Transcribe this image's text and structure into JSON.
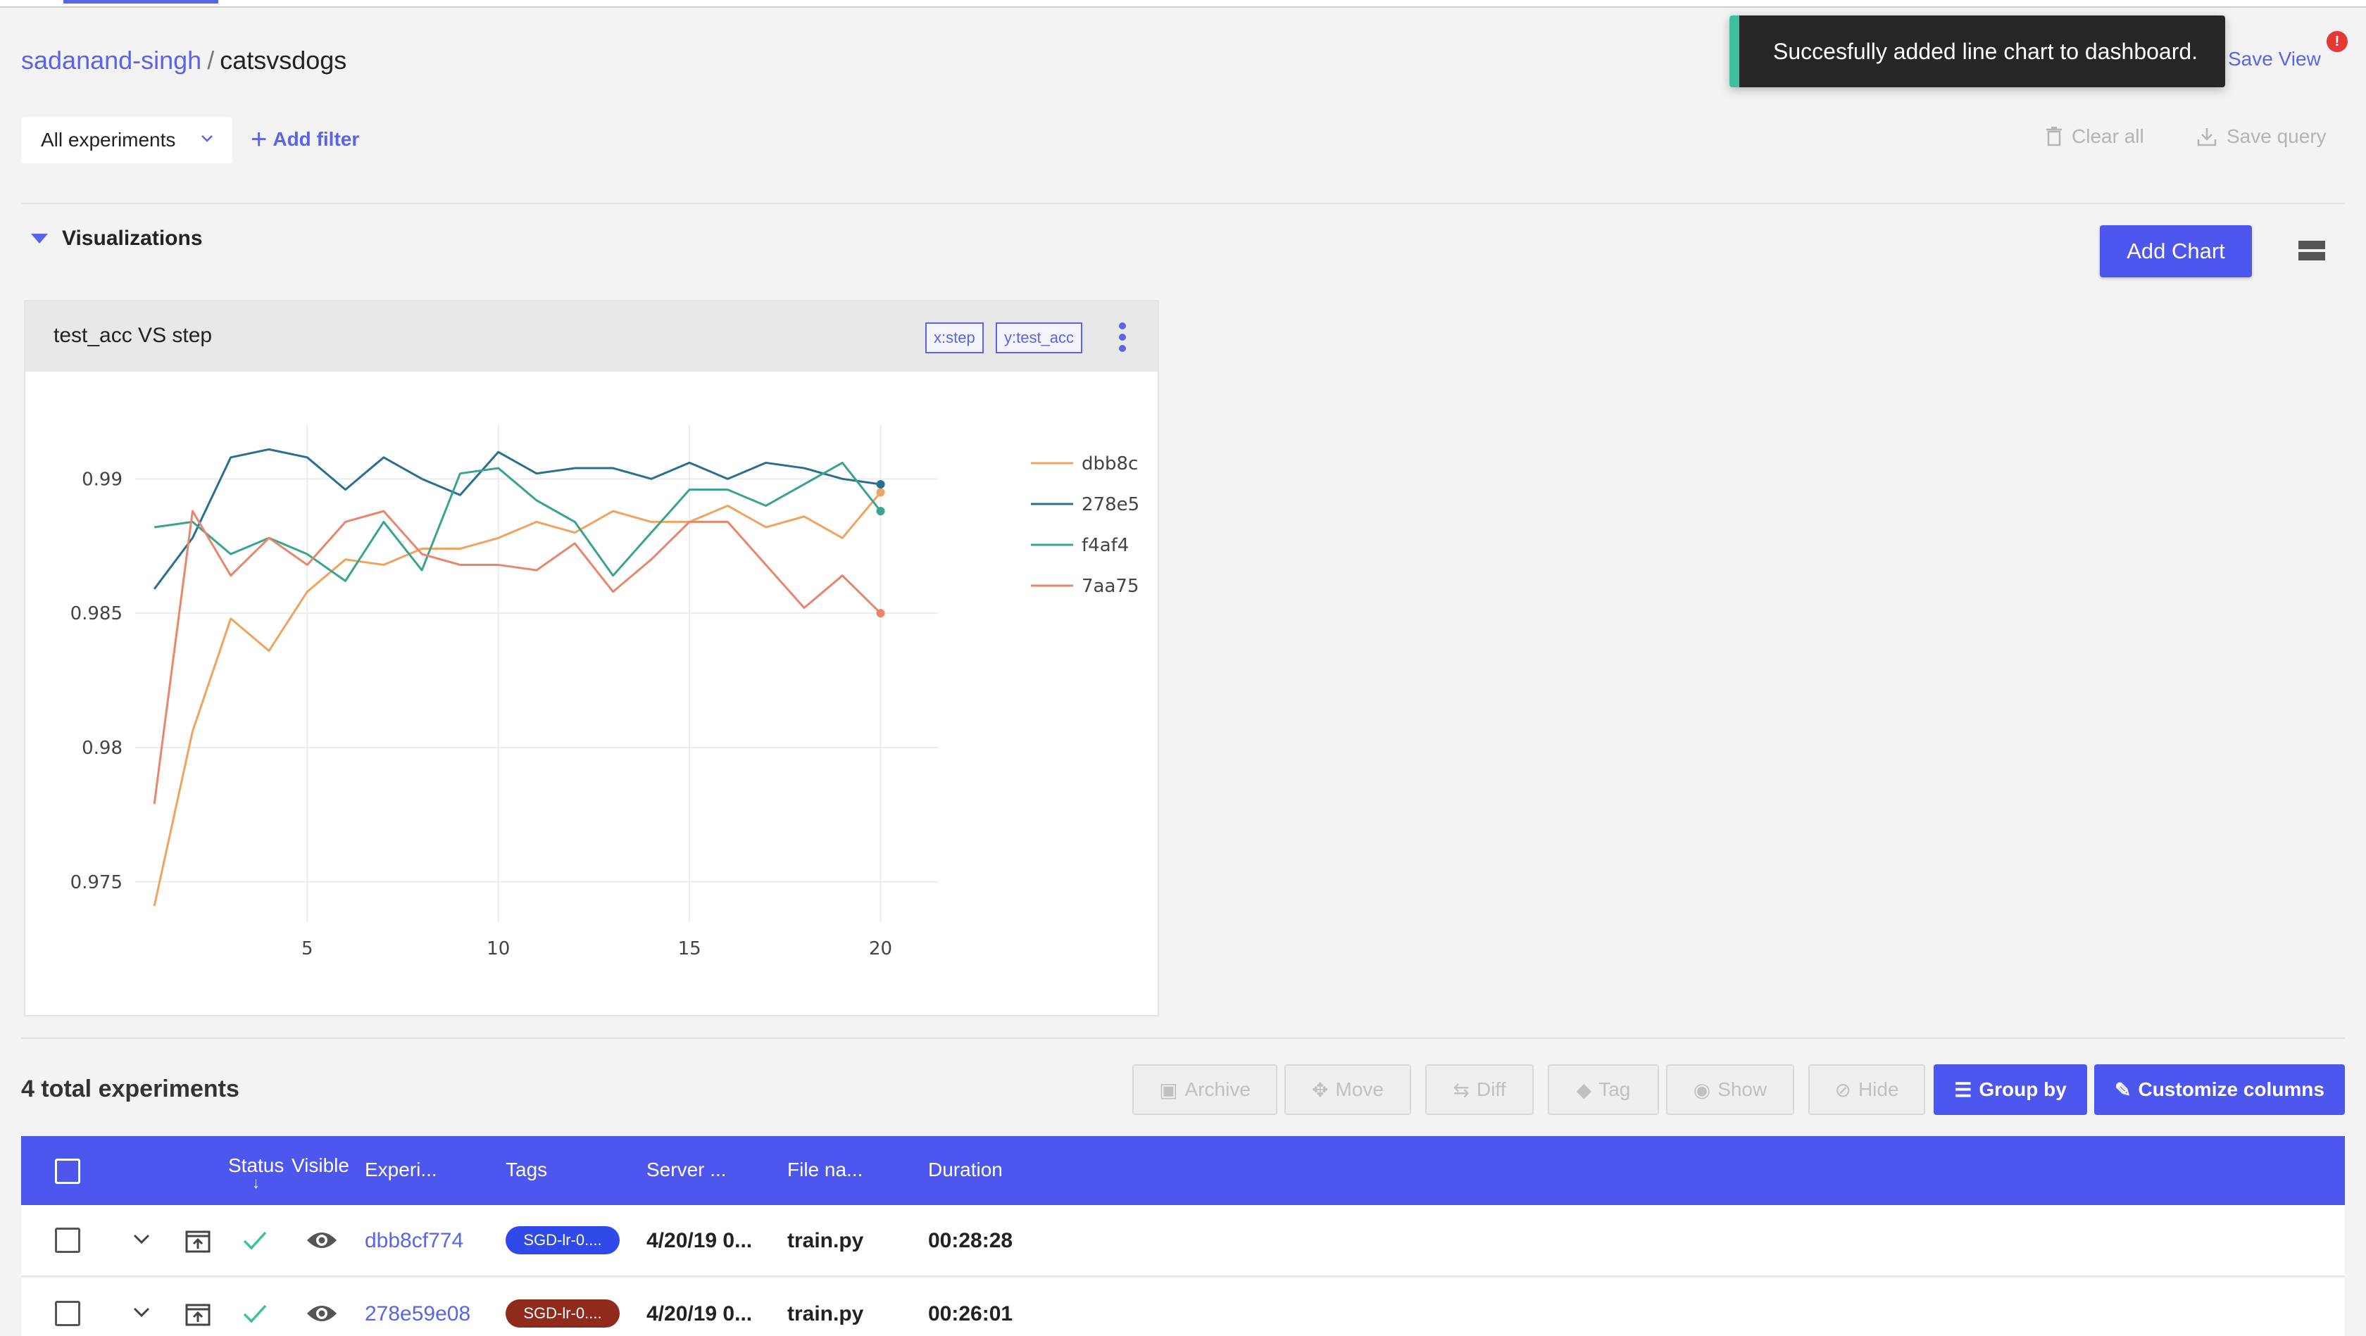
{
  "breadcrumb": {
    "owner": "sadanand-singh",
    "separator": "/",
    "project": "catsvsdogs"
  },
  "toast": {
    "message": "Succesfully added line chart to dashboard.",
    "accent": "#3fbf9b"
  },
  "header": {
    "save_view": "Save View",
    "notification": "!"
  },
  "filters": {
    "experiments_select": "All experiments",
    "add_filter": "Add filter",
    "clear_all": "Clear all",
    "save_query": "Save query"
  },
  "visualizations": {
    "title": "Visualizations",
    "add_chart": "Add Chart"
  },
  "chart_card": {
    "title": "test_acc VS step",
    "x_tag": "x:step",
    "y_tag": "y:test_acc"
  },
  "chart_data": {
    "type": "line",
    "title": "",
    "xlabel": "",
    "ylabel": "",
    "xlim": [
      0.5,
      21.5
    ],
    "ylim": [
      0.9735,
      0.992
    ],
    "xticks": [
      5,
      10,
      15,
      20
    ],
    "yticks": [
      0.975,
      0.98,
      0.985,
      0.99
    ],
    "grid": true,
    "legend_position": "right",
    "x": [
      1,
      2,
      3,
      4,
      5,
      6,
      7,
      8,
      9,
      10,
      11,
      12,
      13,
      14,
      15,
      16,
      17,
      18,
      19,
      20
    ],
    "series": [
      {
        "name": "dbb8c",
        "color": "#f0a35f",
        "values": [
          0.9741,
          0.9806,
          0.9848,
          0.9836,
          0.9858,
          0.987,
          0.9868,
          0.9874,
          0.9874,
          0.9878,
          0.9884,
          0.988,
          0.9888,
          0.9884,
          0.9884,
          0.989,
          0.9882,
          0.9886,
          0.9878,
          0.9895
        ]
      },
      {
        "name": "278e5",
        "color": "#2b6f8e",
        "values": [
          0.9859,
          0.9878,
          0.9908,
          0.9911,
          0.9908,
          0.9896,
          0.9908,
          0.99,
          0.9894,
          0.991,
          0.9902,
          0.9904,
          0.9904,
          0.99,
          0.9906,
          0.99,
          0.9906,
          0.9904,
          0.99,
          0.9898
        ]
      },
      {
        "name": "f4af4",
        "color": "#3aa38f",
        "values": [
          0.9882,
          0.9884,
          0.9872,
          0.9878,
          0.9872,
          0.9862,
          0.9884,
          0.9866,
          0.9902,
          0.9904,
          0.9892,
          0.9884,
          0.9864,
          0.988,
          0.9896,
          0.9896,
          0.989,
          0.9898,
          0.9906,
          0.9888
        ]
      },
      {
        "name": "7aa75",
        "color": "#e8866b",
        "values": [
          0.9779,
          0.9888,
          0.9864,
          0.9878,
          0.9868,
          0.9884,
          0.9888,
          0.9872,
          0.9868,
          0.9868,
          0.9866,
          0.9876,
          0.9858,
          0.987,
          0.9884,
          0.9884,
          0.9868,
          0.9852,
          0.9864,
          0.985
        ]
      }
    ]
  },
  "experiments": {
    "total_label": "4 total experiments",
    "toolbar": {
      "archive": "Archive",
      "move": "Move",
      "diff": "Diff",
      "tag": "Tag",
      "show": "Show",
      "hide": "Hide",
      "group_by": "Group by",
      "customize_columns": "Customize columns"
    },
    "columns": {
      "status": "Status",
      "visible": "Visible",
      "experiment": "Experi...",
      "tags": "Tags",
      "server": "Server ...",
      "file_name": "File na...",
      "duration": "Duration"
    },
    "rows": [
      {
        "id": "dbb8cf774",
        "tag": "SGD-lr-0....",
        "tag_color": "#2f4ae8",
        "server": "4/20/19 0...",
        "file": "train.py",
        "duration": "00:28:28"
      },
      {
        "id": "278e59e08",
        "tag": "SGD-lr-0....",
        "tag_color": "#8f2a1c",
        "server": "4/20/19 0...",
        "file": "train.py",
        "duration": "00:26:01"
      }
    ]
  }
}
